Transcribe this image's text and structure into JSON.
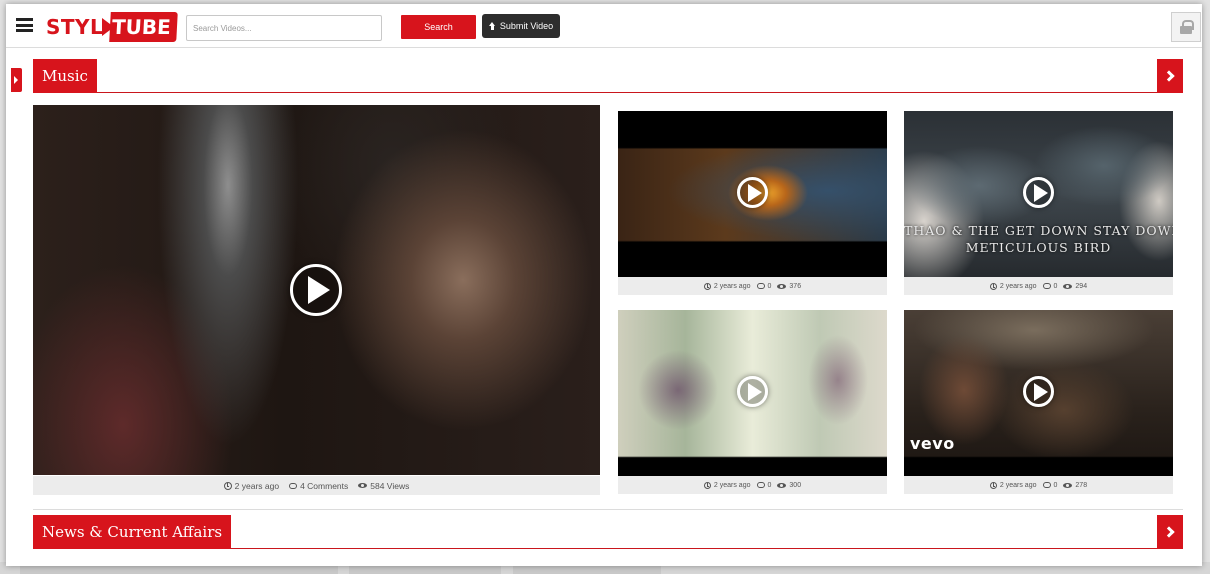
{
  "header": {
    "logo_left": "STYL",
    "logo_right": "TUBE",
    "search_placeholder": "Search Videos...",
    "search_button": "Search",
    "submit_button": "Submit Video"
  },
  "sections": [
    {
      "title": "Music",
      "featured": {
        "time": "2 years ago",
        "comments": "4 Comments",
        "views": "584 Views"
      },
      "videos": [
        {
          "time": "2 years ago",
          "comments": "0",
          "views": "376"
        },
        {
          "time": "2 years ago",
          "comments": "0",
          "views": "294",
          "overlay_line1": "THAO & THE GET DOWN STAY DOWN",
          "overlay_line2": "METICULOUS BIRD"
        },
        {
          "time": "2 years ago",
          "comments": "0",
          "views": "300"
        },
        {
          "time": "2 years ago",
          "comments": "0",
          "views": "278",
          "overlay_logo": "vevo"
        }
      ]
    },
    {
      "title": "News & Current Affairs"
    }
  ],
  "colors": {
    "brand_red": "#d7141c",
    "dark_button": "#2d2d2d",
    "meta_bg": "#ececec"
  }
}
